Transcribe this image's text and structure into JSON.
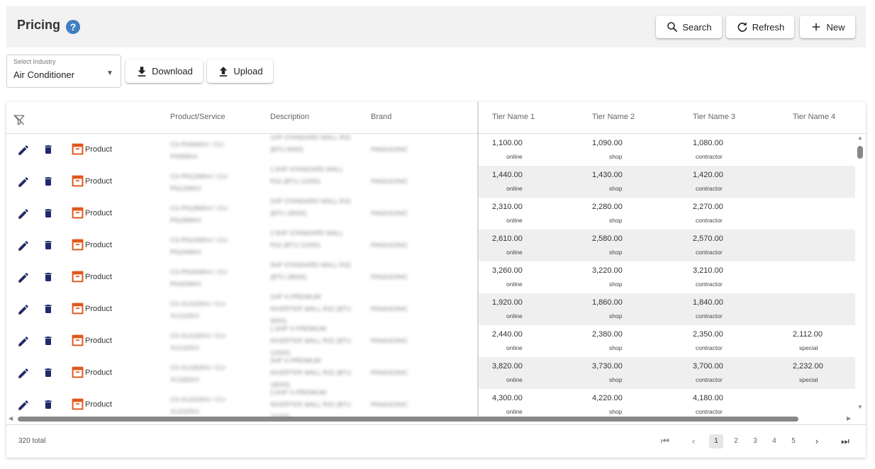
{
  "header": {
    "title": "Pricing",
    "help_glyph": "?",
    "search_label": "Search",
    "refresh_label": "Refresh",
    "new_label": "New"
  },
  "toolbar": {
    "industry_label": "Select Industry",
    "industry_value": "Air Conditioner",
    "download_label": "Download",
    "upload_label": "Upload"
  },
  "table": {
    "columns": [
      "Product/Service",
      "Description",
      "Brand",
      "Tier Name 1",
      "Tier Name 2",
      "Tier Name 3",
      "Tier Name 4"
    ],
    "rows": [
      {
        "type": "Product",
        "product": "CS-PN9WKH / CU-PN9WKH",
        "description": "1HP STANDARD WALL R32 (BTU 9000)",
        "brand": "PANASONIC",
        "t1": "1,100.00",
        "t1l": "online",
        "t2": "1,090.00",
        "t2l": "shop",
        "t3": "1,080.00",
        "t3l": "contractor",
        "t4": "",
        "t4l": ""
      },
      {
        "type": "Product",
        "product": "CS-PN12WKH / CU-PN12WKH",
        "description": "1.5HP STANDARD WALL R32 (BTU 12000)",
        "brand": "PANASONIC",
        "t1": "1,440.00",
        "t1l": "online",
        "t2": "1,430.00",
        "t2l": "shop",
        "t3": "1,420.00",
        "t3l": "contractor",
        "t4": "",
        "t4l": ""
      },
      {
        "type": "Product",
        "product": "CS-PN18WKH / CU-PN18WKH",
        "description": "2HP STANDARD WALL R32 (BTU 18000)",
        "brand": "PANASONIC",
        "t1": "2,310.00",
        "t1l": "online",
        "t2": "2,280.00",
        "t2l": "shop",
        "t3": "2,270.00",
        "t3l": "contractor",
        "t4": "",
        "t4l": ""
      },
      {
        "type": "Product",
        "product": "CS-PN24WKH / CU-PN24WKH",
        "description": "2.5HP STANDARD WALL R32 (BTU 21000)",
        "brand": "PANASONIC",
        "t1": "2,610.00",
        "t1l": "online",
        "t2": "2,580.00",
        "t2l": "shop",
        "t3": "2,570.00",
        "t3l": "contractor",
        "t4": "",
        "t4l": ""
      },
      {
        "type": "Product",
        "product": "CS-PN30WKH / CU-PN30WKH",
        "description": "3HP STANDARD WALL R32 (BTU 28000)",
        "brand": "PANASONIC",
        "t1": "3,260.00",
        "t1l": "online",
        "t2": "3,220.00",
        "t2l": "shop",
        "t3": "3,210.00",
        "t3l": "contractor",
        "t4": "",
        "t4l": ""
      },
      {
        "type": "Product",
        "product": "CS-XU10ZKH / CU-XU10ZKH",
        "description": "1HP X-PREMIUM INVERTER WALL R32 (BTU 9000)",
        "brand": "PANASONIC",
        "t1": "1,920.00",
        "t1l": "online",
        "t2": "1,860.00",
        "t2l": "shop",
        "t3": "1,840.00",
        "t3l": "contractor",
        "t4": "",
        "t4l": ""
      },
      {
        "type": "Product",
        "product": "CS-XU13ZKH / CU-XU13ZKH",
        "description": "1.5HP X-PREMIUM INVERTER WALL R32 (BTU 12000)",
        "brand": "PANASONIC",
        "t1": "2,440.00",
        "t1l": "online",
        "t2": "2,380.00",
        "t2l": "shop",
        "t3": "2,350.00",
        "t3l": "contractor",
        "t4": "2,112.00",
        "t4l": "special"
      },
      {
        "type": "Product",
        "product": "CS-XU18ZKH / CU-XU18ZKH",
        "description": "2HP X-PREMIUM INVERTER WALL R32 (BTU 18000)",
        "brand": "PANASONIC",
        "t1": "3,820.00",
        "t1l": "online",
        "t2": "3,730.00",
        "t2l": "shop",
        "t3": "3,700.00",
        "t3l": "contractor",
        "t4": "2,232.00",
        "t4l": "special"
      },
      {
        "type": "Product",
        "product": "CS-XU24ZKH / CU-XU24ZKH",
        "description": "2.5HP X-PREMIUM INVERTER WALL R32 (BTU 21000)",
        "brand": "PANASONIC",
        "t1": "4,300.00",
        "t1l": "online",
        "t2": "4,220.00",
        "t2l": "shop",
        "t3": "4,180.00",
        "t3l": "contractor",
        "t4": "",
        "t4l": ""
      }
    ]
  },
  "footer": {
    "total": "320 total",
    "pages": [
      "1",
      "2",
      "3",
      "4",
      "5"
    ],
    "current_page": "1"
  },
  "colors": {
    "accent_icon": "#1f2a6b",
    "box_icon": "#e2561b",
    "help_icon": "#3f7fbf",
    "row_shade": "#efefef"
  },
  "icons": {
    "search": "search-icon",
    "refresh": "refresh-icon",
    "new": "plus-icon",
    "download": "download-icon",
    "upload": "upload-icon",
    "filter_clear": "filter-off-icon",
    "edit": "pencil-icon",
    "delete": "trash-icon",
    "product": "box-icon"
  }
}
